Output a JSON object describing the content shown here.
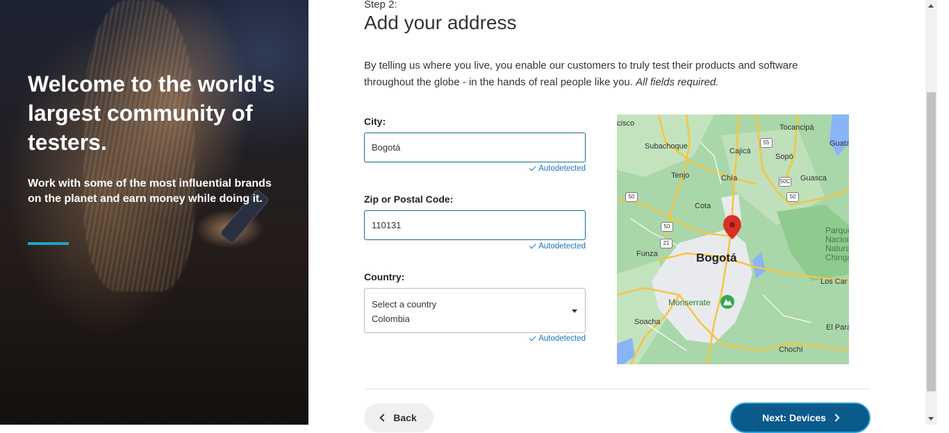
{
  "hero": {
    "headline": "Welcome to the world's largest community of testers.",
    "subtext": "Work with some of the most influential brands on the planet and earn money while doing it.",
    "accent_color": "#1aa7c4"
  },
  "form": {
    "step": "Step 2:",
    "title": "Add your address",
    "description": "By telling us where you live, you enable our customers to truly test their products and software throughout the globe - in the hands of real people like you.",
    "description_note": "All fields required.",
    "city": {
      "label": "City:",
      "value": "Bogotá",
      "status": "Autodetected"
    },
    "zip": {
      "label": "Zip or Postal Code:",
      "value": "110131",
      "status": "Autodetected"
    },
    "country": {
      "label": "Country:",
      "placeholder": "Select a country",
      "value": "Colombia",
      "status": "Autodetected"
    }
  },
  "map": {
    "center_label": "Bogotá",
    "pin_color": "#d93025",
    "places": [
      "cisco",
      "Tocancipá",
      "Subachoque",
      "Cajicá",
      "Guatav",
      "Sopó",
      "Tenjo",
      "Chía",
      "Guasca",
      "Cota",
      "Parque Nacional Natural Chingaz",
      "Funza",
      "Monserrate",
      "Los Car",
      "Soacha",
      "El Para",
      "Chochí"
    ],
    "route_shields": [
      "55",
      "50C",
      "50",
      "50",
      "50",
      "21",
      "50"
    ]
  },
  "nav": {
    "back_label": "Back",
    "next_label": "Next: Devices",
    "next_color": "#0a5a8c"
  }
}
